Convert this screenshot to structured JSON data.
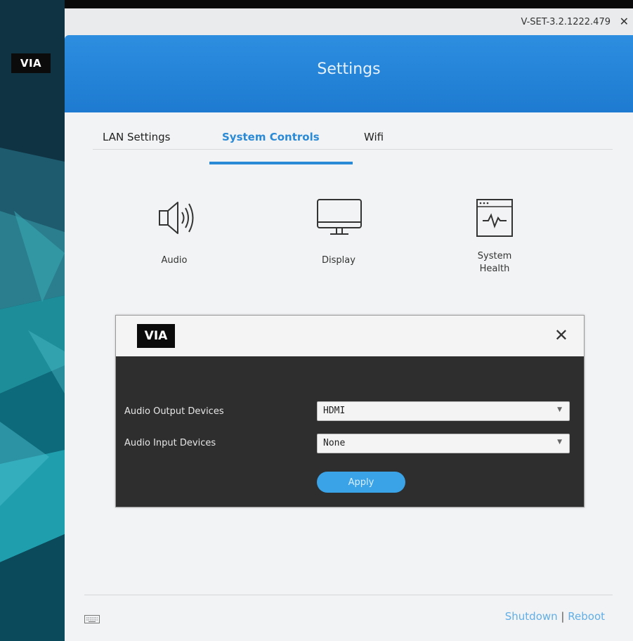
{
  "sidebar": {
    "logo_text": "VIA"
  },
  "window": {
    "version": "V-SET-3.2.1222.479",
    "close_glyph": "✕",
    "title": "Settings"
  },
  "tabs": [
    {
      "label": "LAN Settings",
      "active": false
    },
    {
      "label": "System Controls",
      "active": true
    },
    {
      "label": "Wifi",
      "active": false
    }
  ],
  "tiles": [
    {
      "label": "Audio",
      "icon": "speaker-icon"
    },
    {
      "label": "Display",
      "icon": "monitor-icon"
    },
    {
      "label": "System\nHealth",
      "icon": "system-health-icon"
    }
  ],
  "modal": {
    "logo_text": "VIA",
    "close_glyph": "✕",
    "output_label": "Audio Output Devices",
    "output_value": "HDMI",
    "input_label": "Audio Input Devices",
    "input_value": "None",
    "apply_label": "Apply"
  },
  "footer": {
    "shutdown_label": "Shutdown",
    "separator": "|",
    "reboot_label": "Reboot",
    "keyboard_icon": "keyboard-icon"
  },
  "colors": {
    "accent": "#2a8ad6",
    "header": "#1d7ad0",
    "modal_body": "#2e2e2e",
    "link": "#62aee6"
  }
}
